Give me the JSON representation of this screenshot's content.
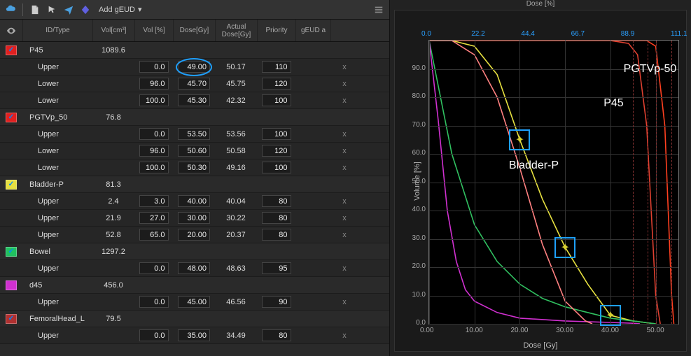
{
  "toolbar": {
    "add_label": "Add gEUD",
    "icons": [
      "cloud-icon",
      "page-icon",
      "arrow-icon",
      "send-icon",
      "diamond-icon"
    ]
  },
  "columns": {
    "eye": "",
    "id": "ID/Type",
    "vol_cm3": "Vol[cm³]",
    "vol_pct": "Vol [%]",
    "dose": "Dose[Gy]",
    "actual_dose": "Actual Dose[Gy]",
    "priority": "Priority",
    "geud_a": "gEUD a"
  },
  "structures": [
    {
      "name": "P45",
      "vol": "1089.6",
      "color": "#e02020",
      "checked": true,
      "objectives": [
        {
          "type": "Upper",
          "vol_pct": "0.0",
          "dose": "49.00",
          "actual": "50.17",
          "priority": "110",
          "highlight": true
        },
        {
          "type": "Lower",
          "vol_pct": "96.0",
          "dose": "45.70",
          "actual": "45.75",
          "priority": "120"
        },
        {
          "type": "Lower",
          "vol_pct": "100.0",
          "dose": "45.30",
          "actual": "42.32",
          "priority": "100"
        }
      ]
    },
    {
      "name": "PGTVp_50",
      "vol": "76.8",
      "color": "#e02020",
      "checked": true,
      "objectives": [
        {
          "type": "Upper",
          "vol_pct": "0.0",
          "dose": "53.50",
          "actual": "53.56",
          "priority": "100"
        },
        {
          "type": "Lower",
          "vol_pct": "96.0",
          "dose": "50.60",
          "actual": "50.58",
          "priority": "120"
        },
        {
          "type": "Lower",
          "vol_pct": "100.0",
          "dose": "50.30",
          "actual": "49.16",
          "priority": "100"
        }
      ]
    },
    {
      "name": "Bladder-P",
      "vol": "81.3",
      "color": "#e6e040",
      "checked": true,
      "objectives": [
        {
          "type": "Upper",
          "vol_cm3": "2.4",
          "vol_pct": "3.0",
          "dose": "40.00",
          "actual": "40.04",
          "priority": "80"
        },
        {
          "type": "Upper",
          "vol_cm3": "21.9",
          "vol_pct": "27.0",
          "dose": "30.00",
          "actual": "30.22",
          "priority": "80"
        },
        {
          "type": "Upper",
          "vol_cm3": "52.8",
          "vol_pct": "65.0",
          "dose": "20.00",
          "actual": "20.37",
          "priority": "80"
        }
      ]
    },
    {
      "name": "Bowel",
      "vol": "1297.2",
      "color": "#20c060",
      "checked": true,
      "objectives": [
        {
          "type": "Upper",
          "vol_pct": "0.0",
          "dose": "48.00",
          "actual": "48.63",
          "priority": "95"
        }
      ]
    },
    {
      "name": "d45",
      "vol": "456.0",
      "color": "#d030d0",
      "checked": false,
      "objectives": [
        {
          "type": "Upper",
          "vol_pct": "0.0",
          "dose": "45.00",
          "actual": "46.56",
          "priority": "90"
        }
      ]
    },
    {
      "name": "FemoralHead_L",
      "vol": "79.5",
      "color": "#b03030",
      "checked": true,
      "objectives": [
        {
          "type": "Upper",
          "vol_pct": "0.0",
          "dose": "35.00",
          "actual": "34.49",
          "priority": "80"
        }
      ]
    }
  ],
  "chart": {
    "top_axis_label": "Dose [%]",
    "x_label": "Dose [Gy]",
    "y_label": "Volume [%]",
    "x_ticks": [
      "0.00",
      "10.00",
      "20.00",
      "30.00",
      "40.00",
      "50.00"
    ],
    "y_ticks": [
      "0.0",
      "10.0",
      "20.0",
      "30.0",
      "40.0",
      "50.0",
      "60.0",
      "70.0",
      "80.0",
      "90.0"
    ],
    "x2_ticks": [
      "0.0",
      "22.2",
      "44.4",
      "66.7",
      "88.9",
      "111.1"
    ],
    "annotations": {
      "pgtvp": "PGTVp-50",
      "p45": "P45",
      "bladder": "Bladder-P"
    },
    "help_icon": "?",
    "expand_icon": "⤢"
  },
  "chart_data": {
    "type": "line",
    "xlabel": "Dose [Gy]",
    "ylabel": "Volume [%]",
    "xlim": [
      0,
      55
    ],
    "ylim": [
      0,
      100
    ],
    "x2label": "Dose [%]",
    "x2lim": [
      0,
      122
    ],
    "series": [
      {
        "name": "P45",
        "color": "#e04030",
        "x": [
          0,
          10,
          20,
          30,
          40,
          44,
          46,
          48,
          50,
          51
        ],
        "y": [
          100,
          100,
          100,
          100,
          100,
          99,
          95,
          70,
          10,
          0
        ]
      },
      {
        "name": "PGTVp-50",
        "color": "#ff4020",
        "x": [
          0,
          20,
          40,
          48,
          50,
          52,
          53.5,
          54
        ],
        "y": [
          100,
          100,
          100,
          100,
          98,
          70,
          10,
          0
        ]
      },
      {
        "name": "Bladder-P",
        "color": "#e6e040",
        "x": [
          0,
          5,
          10,
          15,
          20,
          25,
          30,
          35,
          40,
          45,
          50
        ],
        "y": [
          100,
          100,
          98,
          88,
          65,
          44,
          27,
          14,
          3,
          1,
          0
        ]
      },
      {
        "name": "Bowel",
        "color": "#30c060",
        "x": [
          0,
          5,
          10,
          15,
          20,
          25,
          30,
          35,
          40,
          45,
          48.6,
          50
        ],
        "y": [
          100,
          60,
          35,
          22,
          14,
          9,
          6,
          4,
          2,
          1,
          0.3,
          0
        ]
      },
      {
        "name": "d45",
        "color": "#d030d0",
        "x": [
          0,
          2,
          4,
          6,
          8,
          10,
          15,
          20,
          30,
          40,
          45,
          46.5
        ],
        "y": [
          100,
          72,
          40,
          22,
          12,
          8,
          4,
          2,
          1,
          0.5,
          0.2,
          0
        ]
      },
      {
        "name": "FemoralHead_L",
        "color": "#ff8080",
        "x": [
          0,
          5,
          10,
          15,
          20,
          25,
          30,
          34.5,
          36
        ],
        "y": [
          100,
          100,
          95,
          80,
          55,
          28,
          8,
          1,
          0
        ]
      }
    ],
    "objective_markers": [
      {
        "x": 20,
        "y": 65
      },
      {
        "x": 30,
        "y": 27
      },
      {
        "x": 40,
        "y": 3
      }
    ]
  }
}
